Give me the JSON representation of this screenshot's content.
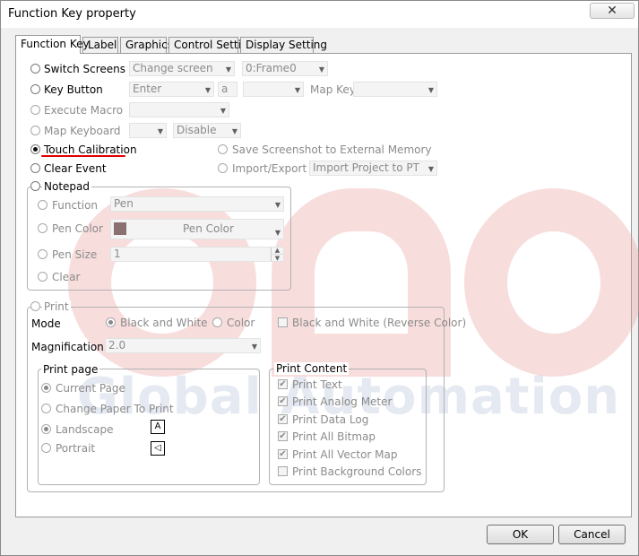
{
  "window": {
    "title": "Function Key property",
    "close_label": "✕"
  },
  "tabs": [
    "Function Key",
    "Label",
    "Graphics",
    "Control Setting",
    "Display Setting"
  ],
  "watermark": {
    "text": "Global Automation"
  },
  "switch_screens": {
    "label": "Switch Screens",
    "mode": "Change screen",
    "frame": "0:Frame0"
  },
  "key_button": {
    "label": "Key Button",
    "key": "Enter",
    "char": "a",
    "map_label": "Map Key"
  },
  "execute_macro": {
    "label": "Execute Macro"
  },
  "map_keyboard": {
    "label": "Map Keyboard",
    "state": "Disable"
  },
  "touch_calibration": {
    "label": "Touch Calibration",
    "selected": true
  },
  "save_screenshot": {
    "label": "Save Screenshot to External Memory"
  },
  "clear_event": {
    "label": "Clear Event"
  },
  "import_export": {
    "label": "Import/Export",
    "value": "Import Project to PT"
  },
  "notepad": {
    "label": "Notepad",
    "function_label": "Function",
    "function_value": "Pen",
    "pen_color_label": "Pen Color",
    "pen_color_value": "Pen Color",
    "pen_color_swatch": "#8a7070",
    "pen_size_label": "Pen Size",
    "pen_size_value": "1",
    "clear_label": "Clear"
  },
  "print": {
    "label": "Print",
    "mode_label": "Mode",
    "bw_label": "Black and White",
    "color_label": "Color",
    "reverse_label": "Black and White (Reverse Color)",
    "magnification_label": "Magnification",
    "magnification_value": "2.0",
    "print_page": {
      "title": "Print page",
      "current_page": "Current Page",
      "change_paper": "Change Paper To Print",
      "landscape": "Landscape",
      "portrait": "Portrait"
    },
    "print_content": {
      "title": "Print Content",
      "items": [
        {
          "label": "Print Text",
          "checked": true
        },
        {
          "label": "Print Analog Meter",
          "checked": true
        },
        {
          "label": "Print Data Log",
          "checked": true
        },
        {
          "label": "Print All Bitmap",
          "checked": true
        },
        {
          "label": "Print All Vector Map",
          "checked": true
        },
        {
          "label": "Print Background Colors",
          "checked": false
        }
      ]
    }
  },
  "buttons": {
    "ok": "OK",
    "cancel": "Cancel"
  },
  "colors": {
    "highlight_underline": "#e00000",
    "watermark_red": "#e89696"
  }
}
